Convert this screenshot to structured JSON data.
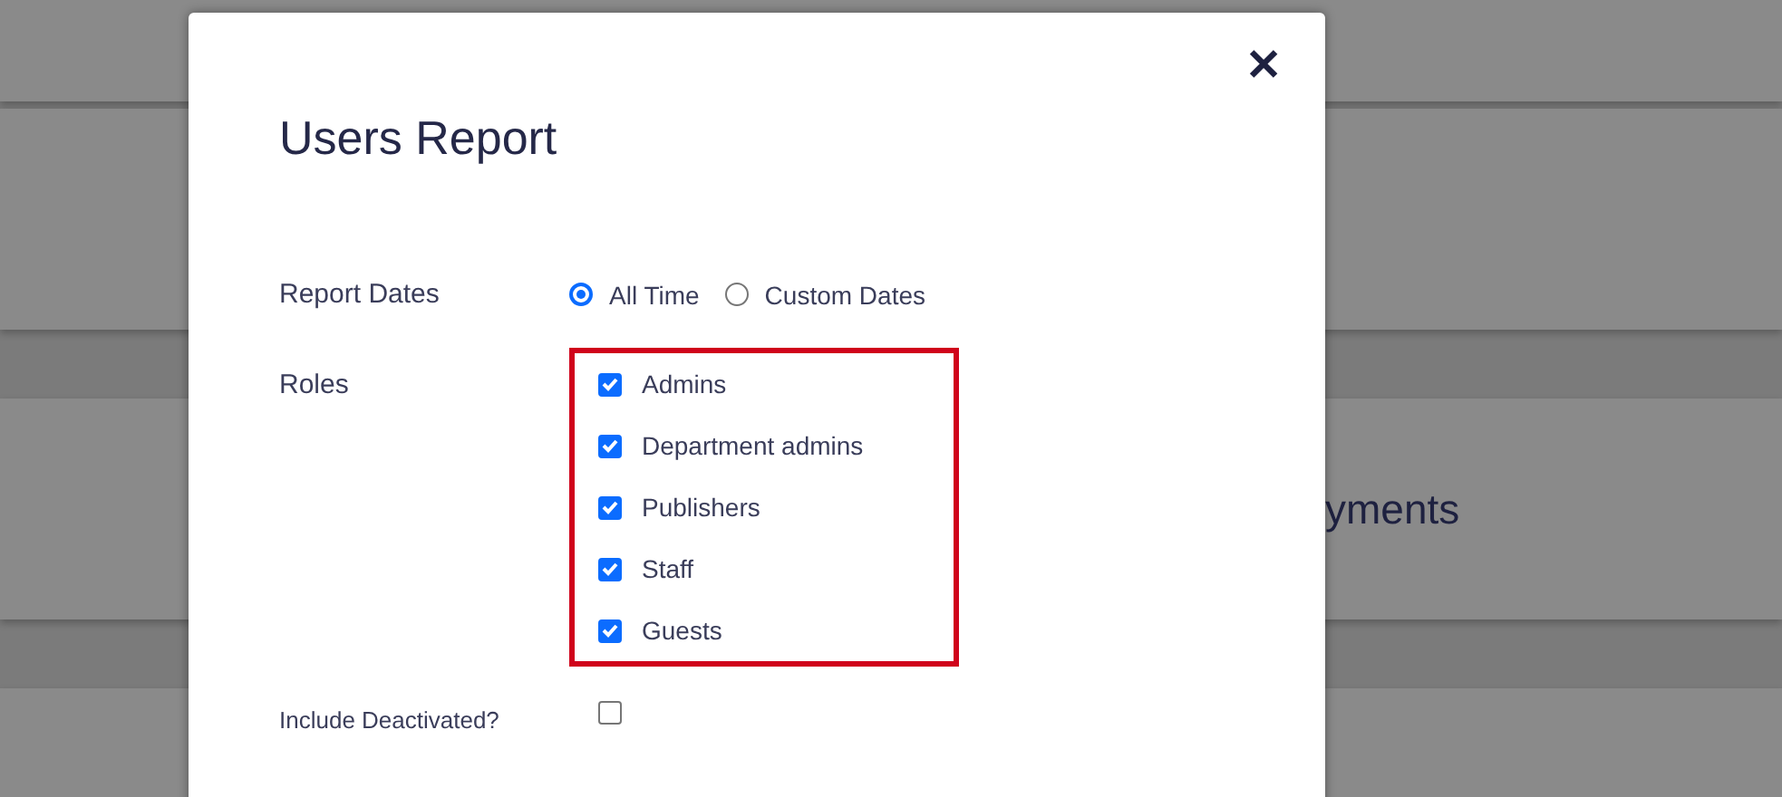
{
  "background": {
    "card_title": "yments"
  },
  "dialog": {
    "title": "Users Report",
    "close": "✕",
    "report_dates": {
      "label": "Report Dates",
      "options": [
        {
          "label": "All Time",
          "selected": true
        },
        {
          "label": "Custom Dates",
          "selected": false
        }
      ]
    },
    "roles": {
      "label": "Roles",
      "highlighted": true,
      "items": [
        {
          "label": "Admins",
          "checked": true
        },
        {
          "label": "Department admins",
          "checked": true
        },
        {
          "label": "Publishers",
          "checked": true
        },
        {
          "label": "Staff",
          "checked": true
        },
        {
          "label": "Guests",
          "checked": true
        }
      ]
    },
    "include_deactivated": {
      "label": "Include Deactivated?",
      "checked": false
    }
  }
}
